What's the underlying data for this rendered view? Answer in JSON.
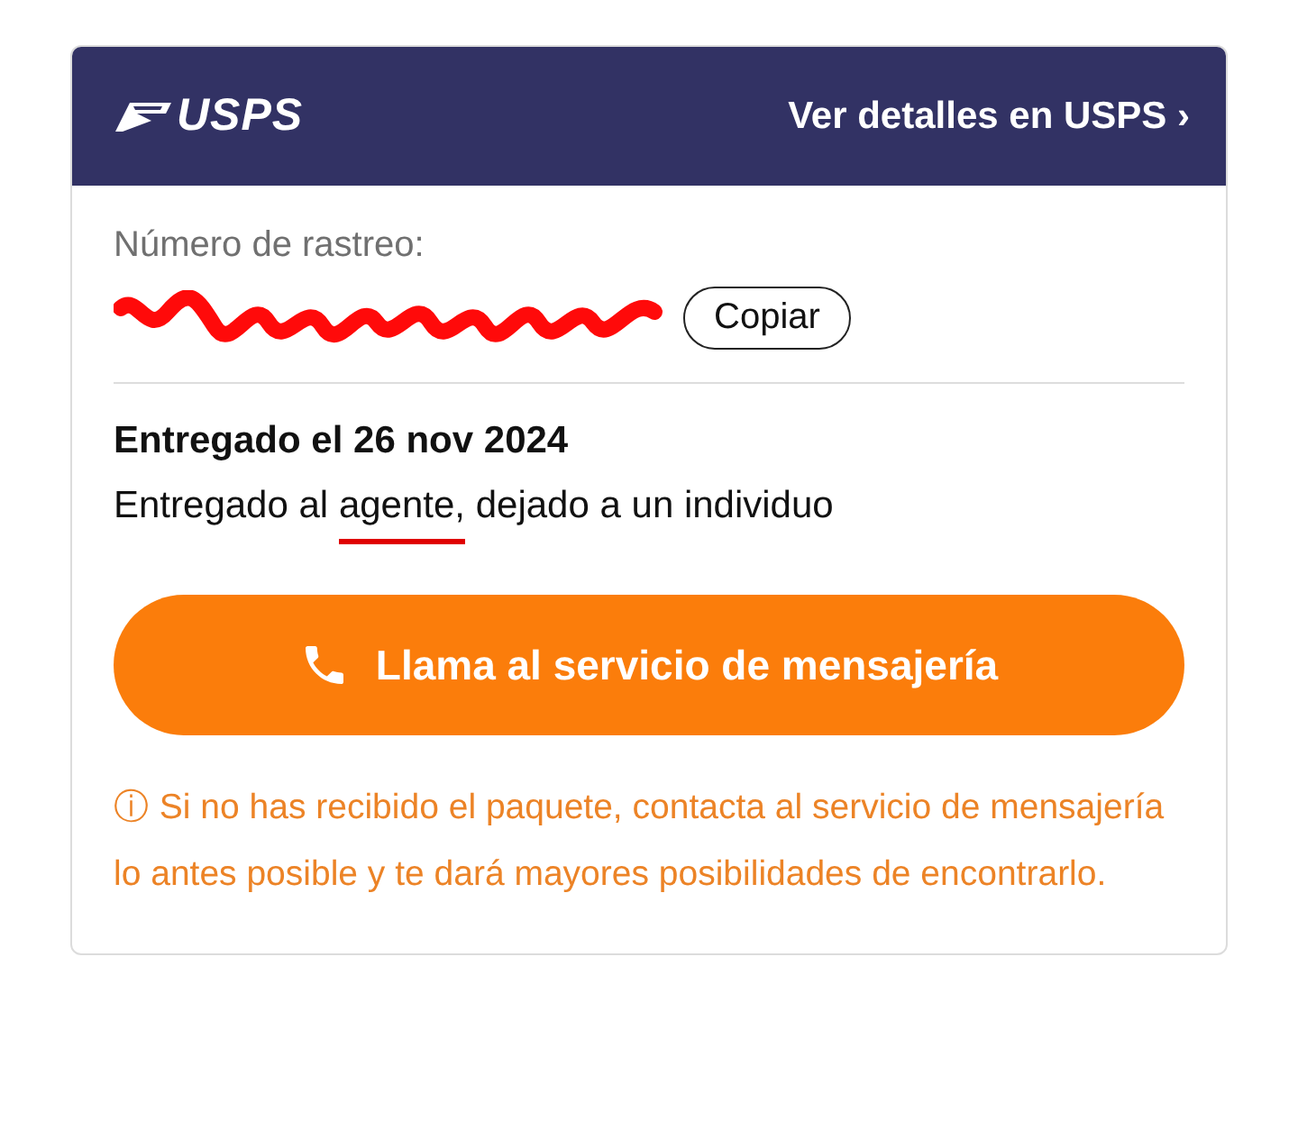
{
  "header": {
    "brand": "USPS",
    "details_link": "Ver detalles en USPS ›"
  },
  "tracking": {
    "label": "Número de rastreo:",
    "redacted": true,
    "copy_button": "Copiar"
  },
  "delivery": {
    "title": "Entregado el 26 nov 2024",
    "status_parts": [
      {
        "text": "Entregado al ",
        "underlined": false
      },
      {
        "text": "agente,",
        "underlined": true
      },
      {
        "text": " dejado a un individuo",
        "underlined": false
      }
    ]
  },
  "call_button": "Llama al servicio de mensajería",
  "notice": {
    "icon": "ⓘ",
    "text": "Si no has recibido el paquete, contacta al servicio de mensajería lo antes posible y te dará mayores posibilidades de encontrarlo."
  }
}
